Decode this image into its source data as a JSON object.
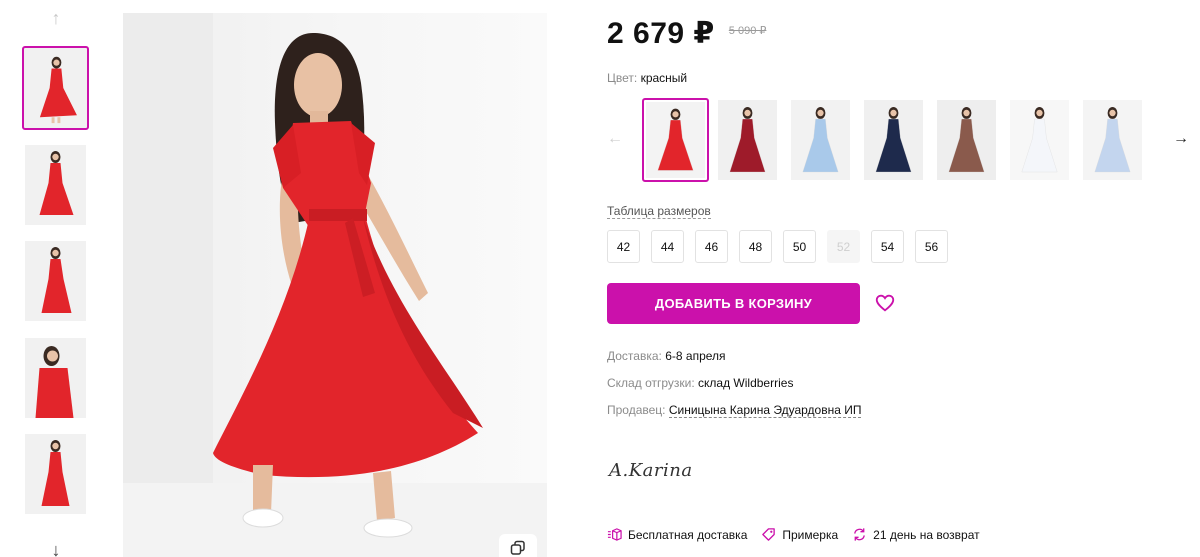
{
  "product": {
    "price": "2 679 ₽",
    "old_price": "5 090 ₽",
    "color_label": "Цвет:",
    "color_value": "красный"
  },
  "size_table_link": "Таблица размеров",
  "sizes": [
    {
      "label": "42",
      "available": true
    },
    {
      "label": "44",
      "available": true
    },
    {
      "label": "46",
      "available": true
    },
    {
      "label": "48",
      "available": true
    },
    {
      "label": "50",
      "available": true
    },
    {
      "label": "52",
      "available": false
    },
    {
      "label": "54",
      "available": true
    },
    {
      "label": "56",
      "available": true
    }
  ],
  "add_to_cart": "ДОБАВИТЬ В КОРЗИНУ",
  "delivery": {
    "label": "Доставка:",
    "value": "6-8 апреля"
  },
  "warehouse": {
    "label": "Склад отгрузки:",
    "value": "склад Wildberries"
  },
  "seller": {
    "label": "Продавец:",
    "value": "Синицына Карина Эдуардовна ИП"
  },
  "brand_logo": "A.Karina",
  "features": [
    {
      "icon": "delivery-box-icon",
      "label": "Бесплатная доставка"
    },
    {
      "icon": "tag-icon",
      "label": "Примерка"
    },
    {
      "icon": "return-arrows-icon",
      "label": "21 день на возврат"
    }
  ],
  "color_swatches": [
    {
      "name": "red",
      "dress": "#e2252b",
      "bg": "#f3f3f3",
      "active": true
    },
    {
      "name": "burgundy",
      "dress": "#9e1b2a",
      "bg": "#f0f0f0",
      "active": false
    },
    {
      "name": "light-blue",
      "dress": "#a9c9ea",
      "bg": "#f2f2f2",
      "active": false
    },
    {
      "name": "navy",
      "dress": "#1e2a4c",
      "bg": "#f0f0f0",
      "active": false
    },
    {
      "name": "brown",
      "dress": "#8a5a4c",
      "bg": "#eeeeee",
      "active": false
    },
    {
      "name": "white",
      "dress": "#f4f6fa",
      "bg": "#f7f7f7",
      "active": false
    },
    {
      "name": "pale-blue",
      "dress": "#c3d5ee",
      "bg": "#f4f4f4",
      "active": false
    }
  ],
  "colors": {
    "accent": "#cb11ab",
    "dress_main": "#e2252b"
  }
}
